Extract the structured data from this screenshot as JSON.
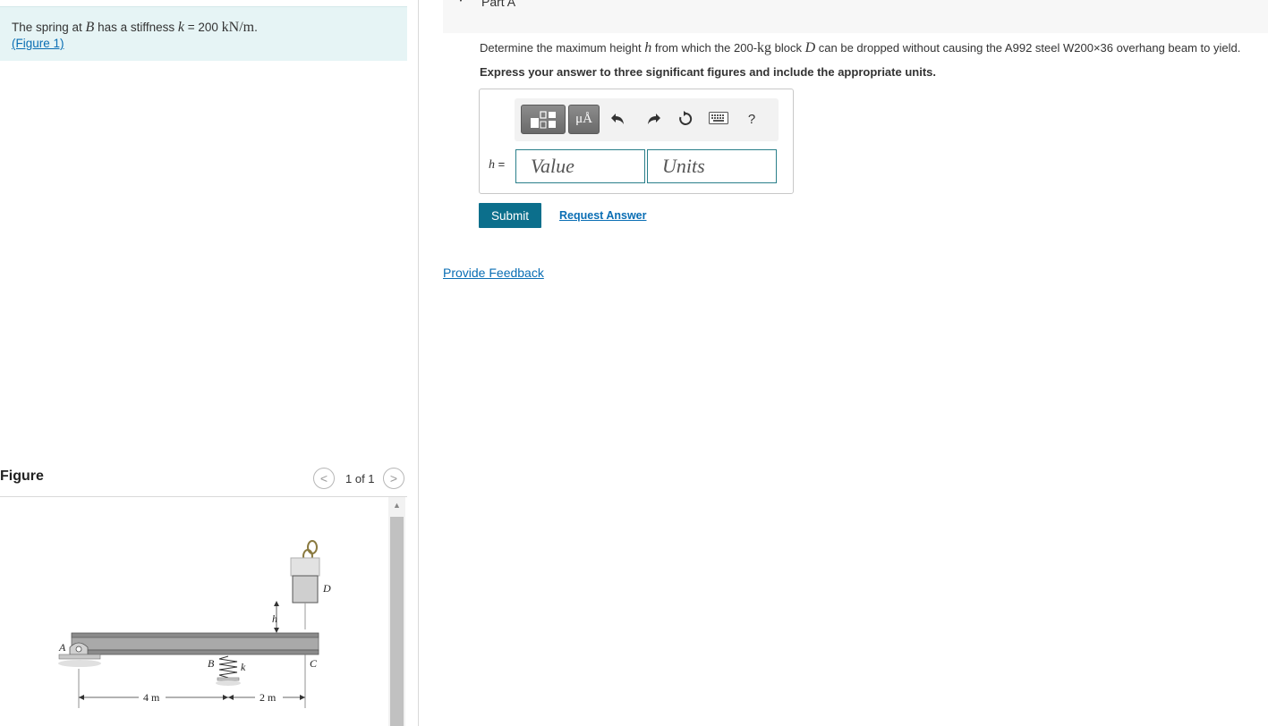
{
  "problem": {
    "text_before": "The spring at ",
    "var_b": "B",
    "text_mid": " has a stiffness ",
    "var_k": "k",
    "text_eq": " = 200 ",
    "unit": "kN/m",
    "text_end": ".",
    "figure_link": "(Figure 1)"
  },
  "figure_panel": {
    "title": "Figure",
    "count": "1 of 1",
    "prev_glyph": "<",
    "next_glyph": ">",
    "diagram": {
      "label_a": "A",
      "label_b": "B",
      "label_k": "k",
      "label_c": "C",
      "label_d": "D",
      "label_h": "h",
      "dim_left": "4 m",
      "dim_right": "2 m"
    }
  },
  "part": {
    "title": "Part A",
    "question_1": "Determine the maximum height ",
    "var_h": "h",
    "question_2": " from which the 200-",
    "unit_kg": "kg",
    "question_3": " block ",
    "var_d": "D",
    "question_4": " can be dropped without causing the A992 steel W200×36 overhang beam to yield.",
    "instruction": "Express your answer to three significant figures and include the appropriate units."
  },
  "answer": {
    "toolbar": {
      "units_label": "μÅ",
      "help_label": "?"
    },
    "h_var": "h",
    "h_eq": " =",
    "value_placeholder": "Value",
    "units_placeholder": "Units"
  },
  "actions": {
    "submit": "Submit",
    "request_answer": "Request Answer",
    "provide_feedback": "Provide Feedback"
  },
  "colors": {
    "accent": "#0c6f8c",
    "link": "#0a6eb4",
    "problem_bg": "#e6f4f5"
  }
}
